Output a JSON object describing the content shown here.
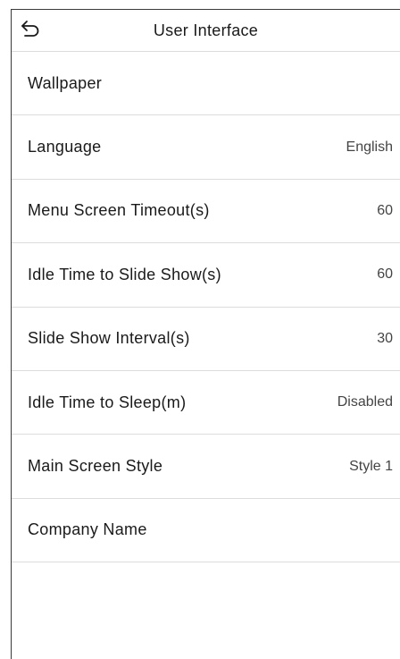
{
  "header": {
    "title": "User Interface",
    "back_icon": "back-arrow-icon"
  },
  "settings": [
    {
      "label": "Wallpaper",
      "value": ""
    },
    {
      "label": "Language",
      "value": "English"
    },
    {
      "label": "Menu Screen Timeout(s)",
      "value": "60"
    },
    {
      "label": "Idle Time to Slide Show(s)",
      "value": "60"
    },
    {
      "label": "Slide Show Interval(s)",
      "value": "30"
    },
    {
      "label": "Idle Time to Sleep(m)",
      "value": "Disabled"
    },
    {
      "label": "Main Screen Style",
      "value": "Style 1"
    },
    {
      "label": "Company Name",
      "value": ""
    }
  ]
}
